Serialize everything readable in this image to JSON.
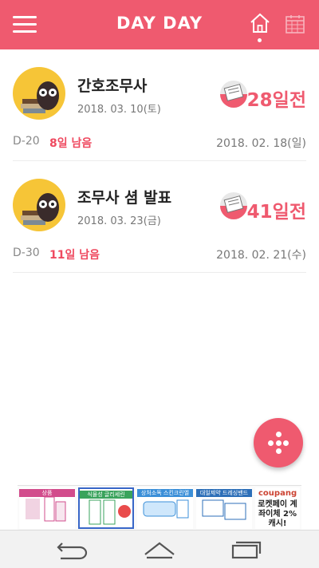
{
  "app": {
    "title": "DAY DAY"
  },
  "icons": {
    "menu": "hamburger-icon",
    "home": "home-icon",
    "calendar": "calendar-icon",
    "fab": "dots-icon"
  },
  "colors": {
    "accent": "#ef5a6f",
    "avatar_bg": "#f6c537",
    "text_red": "#ef4a60"
  },
  "cards": [
    {
      "name": "간호조무사",
      "date": "2018. 03. 10(토)",
      "days_before": "28일전",
      "d_label": "D-20",
      "remaining": "8일 남음",
      "target_date": "2018. 02. 18(일)"
    },
    {
      "name": "조무사 셤 발표",
      "date": "2018. 03. 23(금)",
      "days_before": "41일전",
      "d_label": "D-30",
      "remaining": "11일 남음",
      "target_date": "2018. 02. 21(수)"
    }
  ],
  "ads": [
    {
      "label": "상품",
      "color": "#d24c8c"
    },
    {
      "label": "식물성 글리세린",
      "color": "#3aa35c"
    },
    {
      "label": "상처소독 스킨크린엘",
      "color": "#3b8fd8"
    },
    {
      "label": "대일제약 드레싱밴드",
      "color": "#2d6fb8"
    },
    {
      "label_logo": "coupang",
      "text": "로켓페이 계좌이체 2%캐시!"
    }
  ]
}
